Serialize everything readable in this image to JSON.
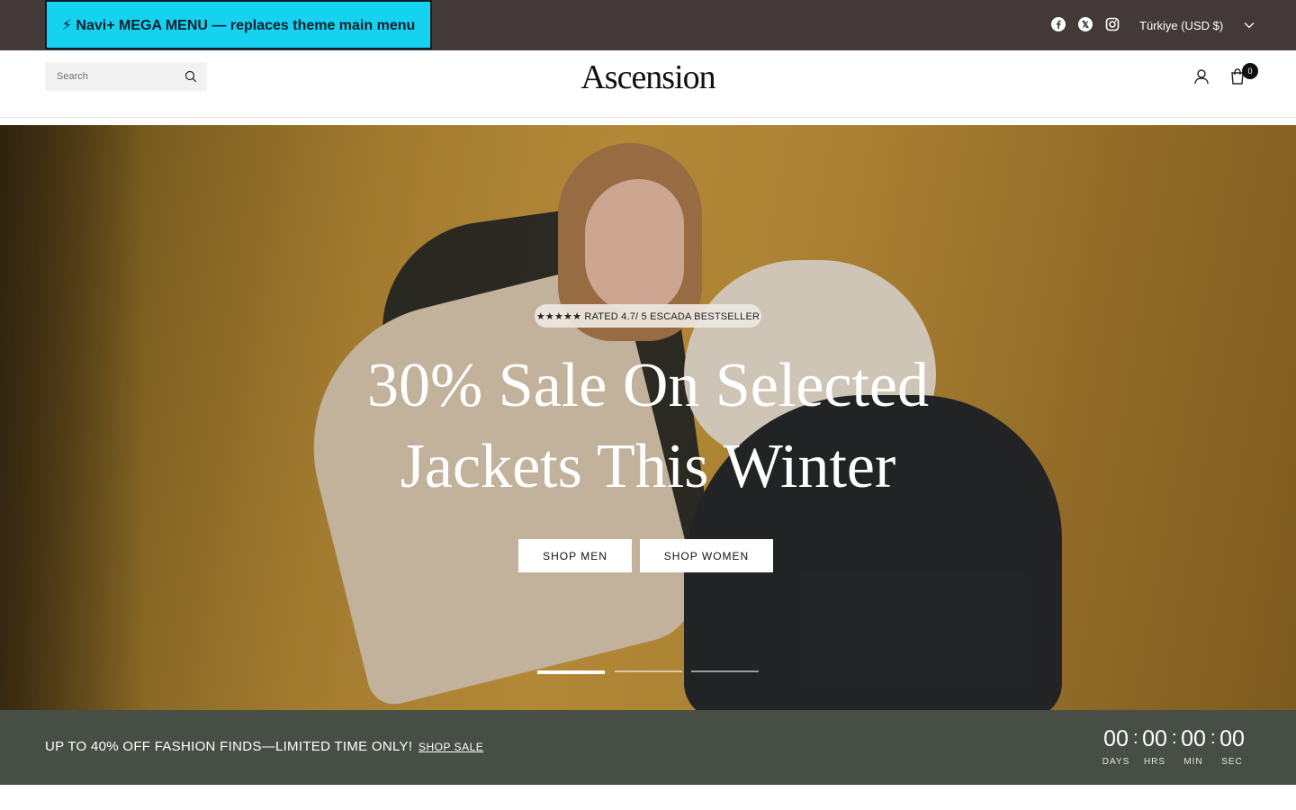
{
  "topbar": {
    "mega_menu_label": "⚡ Navi+ MEGA MENU — replaces theme main menu",
    "social": [
      "facebook-icon",
      "x-twitter-icon",
      "instagram-icon"
    ],
    "locale_label": "Türkiye (USD $)"
  },
  "header": {
    "search_placeholder": "Search",
    "logo": "Ascension",
    "cart_count": "0"
  },
  "hero": {
    "badge": "★★★★★ RATED 4.7/ 5 ESCADA BESTSELLER",
    "title_line1": "30% Sale On Selected",
    "title_line2": "Jackets This Winter",
    "buttons": [
      "SHOP MEN",
      "SHOP WOMEN"
    ],
    "slides": 3,
    "active_slide": 1
  },
  "promo": {
    "text": "UP TO 40% OFF FASHION FINDS—LIMITED TIME ONLY!",
    "link": "SHOP SALE",
    "countdown": [
      {
        "value": "00",
        "label": "DAYS"
      },
      {
        "value": "00",
        "label": "HRS"
      },
      {
        "value": "00",
        "label": "MIN"
      },
      {
        "value": "00",
        "label": "SEC"
      }
    ]
  },
  "colors": {
    "topbar_bg": "#433939",
    "mega_menu_bg": "#14d2f0",
    "promo_bg": "#474e45"
  }
}
